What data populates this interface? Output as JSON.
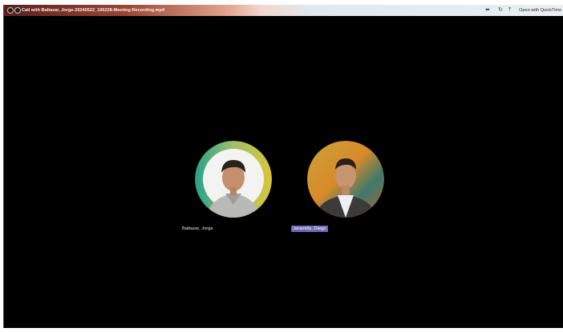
{
  "window": {
    "title": "Call with Baltazar, Jorge-20240522_105228-Meeting Recording.mp4",
    "open_with_label": "Open with QuickTime Pla",
    "icons": [
      "audio-icon",
      "rotate-icon",
      "share-icon"
    ]
  },
  "participants": [
    {
      "name": "Baltazar, Jorge",
      "speaking": false
    },
    {
      "name": "Jaramillo, Diego",
      "speaking": true
    }
  ],
  "colors": {
    "background": "#000000",
    "active_speaker_label": "#6f6ab4",
    "ring_gradient": [
      "#27a08a",
      "#d4c43a"
    ]
  }
}
